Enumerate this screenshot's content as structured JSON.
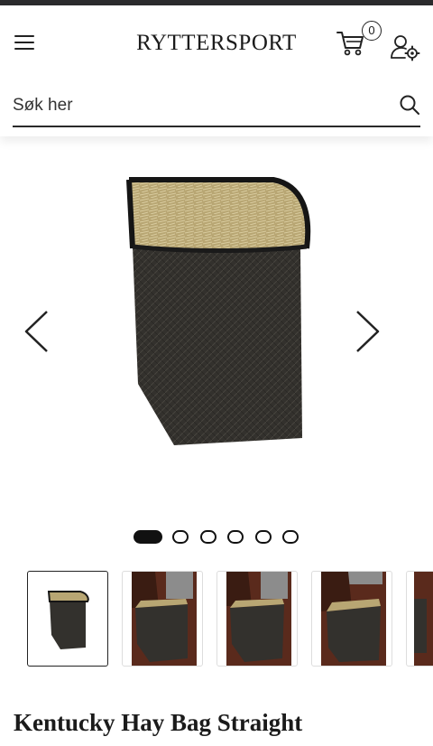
{
  "header": {
    "logo_text": "RYTTERSPORT",
    "menu_icon": "hamburger-menu-icon",
    "cart_icon": "shopping-cart-icon",
    "cart_count": "0",
    "account_icon": "user-settings-icon"
  },
  "search": {
    "placeholder": "Søk her",
    "icon": "search-icon"
  },
  "gallery": {
    "prev_icon": "chevron-left-icon",
    "next_icon": "chevron-right-icon",
    "main_image": "hay-bag-product-image",
    "slide_count": 6,
    "active_slide": 1
  },
  "thumbnails": [
    {
      "image": "hay-bag-thumbnail",
      "active": true
    },
    {
      "image": "hay-bag-with-horse-thumbnail",
      "active": false
    },
    {
      "image": "hay-bag-with-horse-thumbnail",
      "active": false
    },
    {
      "image": "hay-bag-with-horse-thumbnail",
      "active": false
    },
    {
      "image": "hay-bag-thumbnail-partial",
      "active": false
    }
  ],
  "product": {
    "title": "Kentucky Hay Bag Straight"
  },
  "colors": {
    "top_strip": "#2b2b2d",
    "text": "#1b1b1b",
    "bag": "#2e2c29",
    "hay": "#bfae7e",
    "stall_wood": "#5a2a1c"
  }
}
